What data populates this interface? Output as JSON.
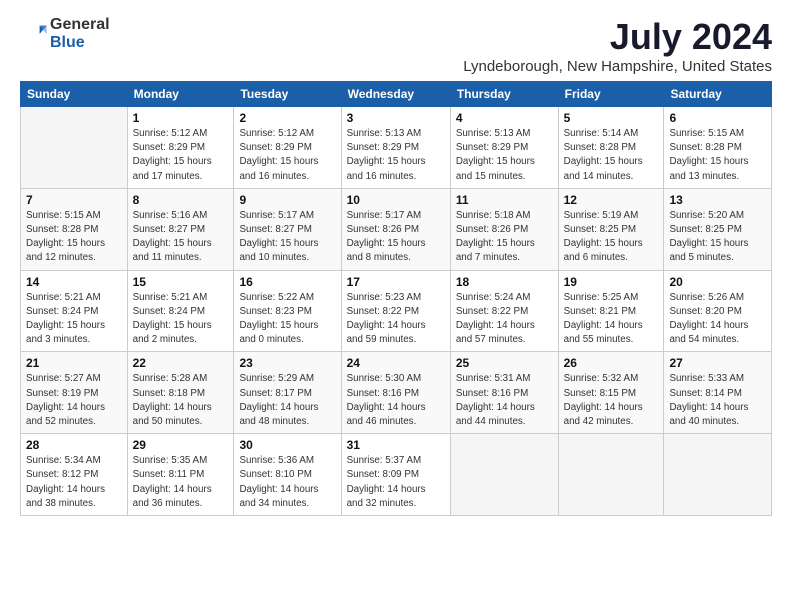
{
  "logo": {
    "general": "General",
    "blue": "Blue"
  },
  "title": "July 2024",
  "location": "Lyndeborough, New Hampshire, United States",
  "headers": [
    "Sunday",
    "Monday",
    "Tuesday",
    "Wednesday",
    "Thursday",
    "Friday",
    "Saturday"
  ],
  "weeks": [
    [
      {
        "day": "",
        "info": ""
      },
      {
        "day": "1",
        "info": "Sunrise: 5:12 AM\nSunset: 8:29 PM\nDaylight: 15 hours\nand 17 minutes."
      },
      {
        "day": "2",
        "info": "Sunrise: 5:12 AM\nSunset: 8:29 PM\nDaylight: 15 hours\nand 16 minutes."
      },
      {
        "day": "3",
        "info": "Sunrise: 5:13 AM\nSunset: 8:29 PM\nDaylight: 15 hours\nand 16 minutes."
      },
      {
        "day": "4",
        "info": "Sunrise: 5:13 AM\nSunset: 8:29 PM\nDaylight: 15 hours\nand 15 minutes."
      },
      {
        "day": "5",
        "info": "Sunrise: 5:14 AM\nSunset: 8:28 PM\nDaylight: 15 hours\nand 14 minutes."
      },
      {
        "day": "6",
        "info": "Sunrise: 5:15 AM\nSunset: 8:28 PM\nDaylight: 15 hours\nand 13 minutes."
      }
    ],
    [
      {
        "day": "7",
        "info": "Sunrise: 5:15 AM\nSunset: 8:28 PM\nDaylight: 15 hours\nand 12 minutes."
      },
      {
        "day": "8",
        "info": "Sunrise: 5:16 AM\nSunset: 8:27 PM\nDaylight: 15 hours\nand 11 minutes."
      },
      {
        "day": "9",
        "info": "Sunrise: 5:17 AM\nSunset: 8:27 PM\nDaylight: 15 hours\nand 10 minutes."
      },
      {
        "day": "10",
        "info": "Sunrise: 5:17 AM\nSunset: 8:26 PM\nDaylight: 15 hours\nand 8 minutes."
      },
      {
        "day": "11",
        "info": "Sunrise: 5:18 AM\nSunset: 8:26 PM\nDaylight: 15 hours\nand 7 minutes."
      },
      {
        "day": "12",
        "info": "Sunrise: 5:19 AM\nSunset: 8:25 PM\nDaylight: 15 hours\nand 6 minutes."
      },
      {
        "day": "13",
        "info": "Sunrise: 5:20 AM\nSunset: 8:25 PM\nDaylight: 15 hours\nand 5 minutes."
      }
    ],
    [
      {
        "day": "14",
        "info": "Sunrise: 5:21 AM\nSunset: 8:24 PM\nDaylight: 15 hours\nand 3 minutes."
      },
      {
        "day": "15",
        "info": "Sunrise: 5:21 AM\nSunset: 8:24 PM\nDaylight: 15 hours\nand 2 minutes."
      },
      {
        "day": "16",
        "info": "Sunrise: 5:22 AM\nSunset: 8:23 PM\nDaylight: 15 hours\nand 0 minutes."
      },
      {
        "day": "17",
        "info": "Sunrise: 5:23 AM\nSunset: 8:22 PM\nDaylight: 14 hours\nand 59 minutes."
      },
      {
        "day": "18",
        "info": "Sunrise: 5:24 AM\nSunset: 8:22 PM\nDaylight: 14 hours\nand 57 minutes."
      },
      {
        "day": "19",
        "info": "Sunrise: 5:25 AM\nSunset: 8:21 PM\nDaylight: 14 hours\nand 55 minutes."
      },
      {
        "day": "20",
        "info": "Sunrise: 5:26 AM\nSunset: 8:20 PM\nDaylight: 14 hours\nand 54 minutes."
      }
    ],
    [
      {
        "day": "21",
        "info": "Sunrise: 5:27 AM\nSunset: 8:19 PM\nDaylight: 14 hours\nand 52 minutes."
      },
      {
        "day": "22",
        "info": "Sunrise: 5:28 AM\nSunset: 8:18 PM\nDaylight: 14 hours\nand 50 minutes."
      },
      {
        "day": "23",
        "info": "Sunrise: 5:29 AM\nSunset: 8:17 PM\nDaylight: 14 hours\nand 48 minutes."
      },
      {
        "day": "24",
        "info": "Sunrise: 5:30 AM\nSunset: 8:16 PM\nDaylight: 14 hours\nand 46 minutes."
      },
      {
        "day": "25",
        "info": "Sunrise: 5:31 AM\nSunset: 8:16 PM\nDaylight: 14 hours\nand 44 minutes."
      },
      {
        "day": "26",
        "info": "Sunrise: 5:32 AM\nSunset: 8:15 PM\nDaylight: 14 hours\nand 42 minutes."
      },
      {
        "day": "27",
        "info": "Sunrise: 5:33 AM\nSunset: 8:14 PM\nDaylight: 14 hours\nand 40 minutes."
      }
    ],
    [
      {
        "day": "28",
        "info": "Sunrise: 5:34 AM\nSunset: 8:12 PM\nDaylight: 14 hours\nand 38 minutes."
      },
      {
        "day": "29",
        "info": "Sunrise: 5:35 AM\nSunset: 8:11 PM\nDaylight: 14 hours\nand 36 minutes."
      },
      {
        "day": "30",
        "info": "Sunrise: 5:36 AM\nSunset: 8:10 PM\nDaylight: 14 hours\nand 34 minutes."
      },
      {
        "day": "31",
        "info": "Sunrise: 5:37 AM\nSunset: 8:09 PM\nDaylight: 14 hours\nand 32 minutes."
      },
      {
        "day": "",
        "info": ""
      },
      {
        "day": "",
        "info": ""
      },
      {
        "day": "",
        "info": ""
      }
    ]
  ]
}
